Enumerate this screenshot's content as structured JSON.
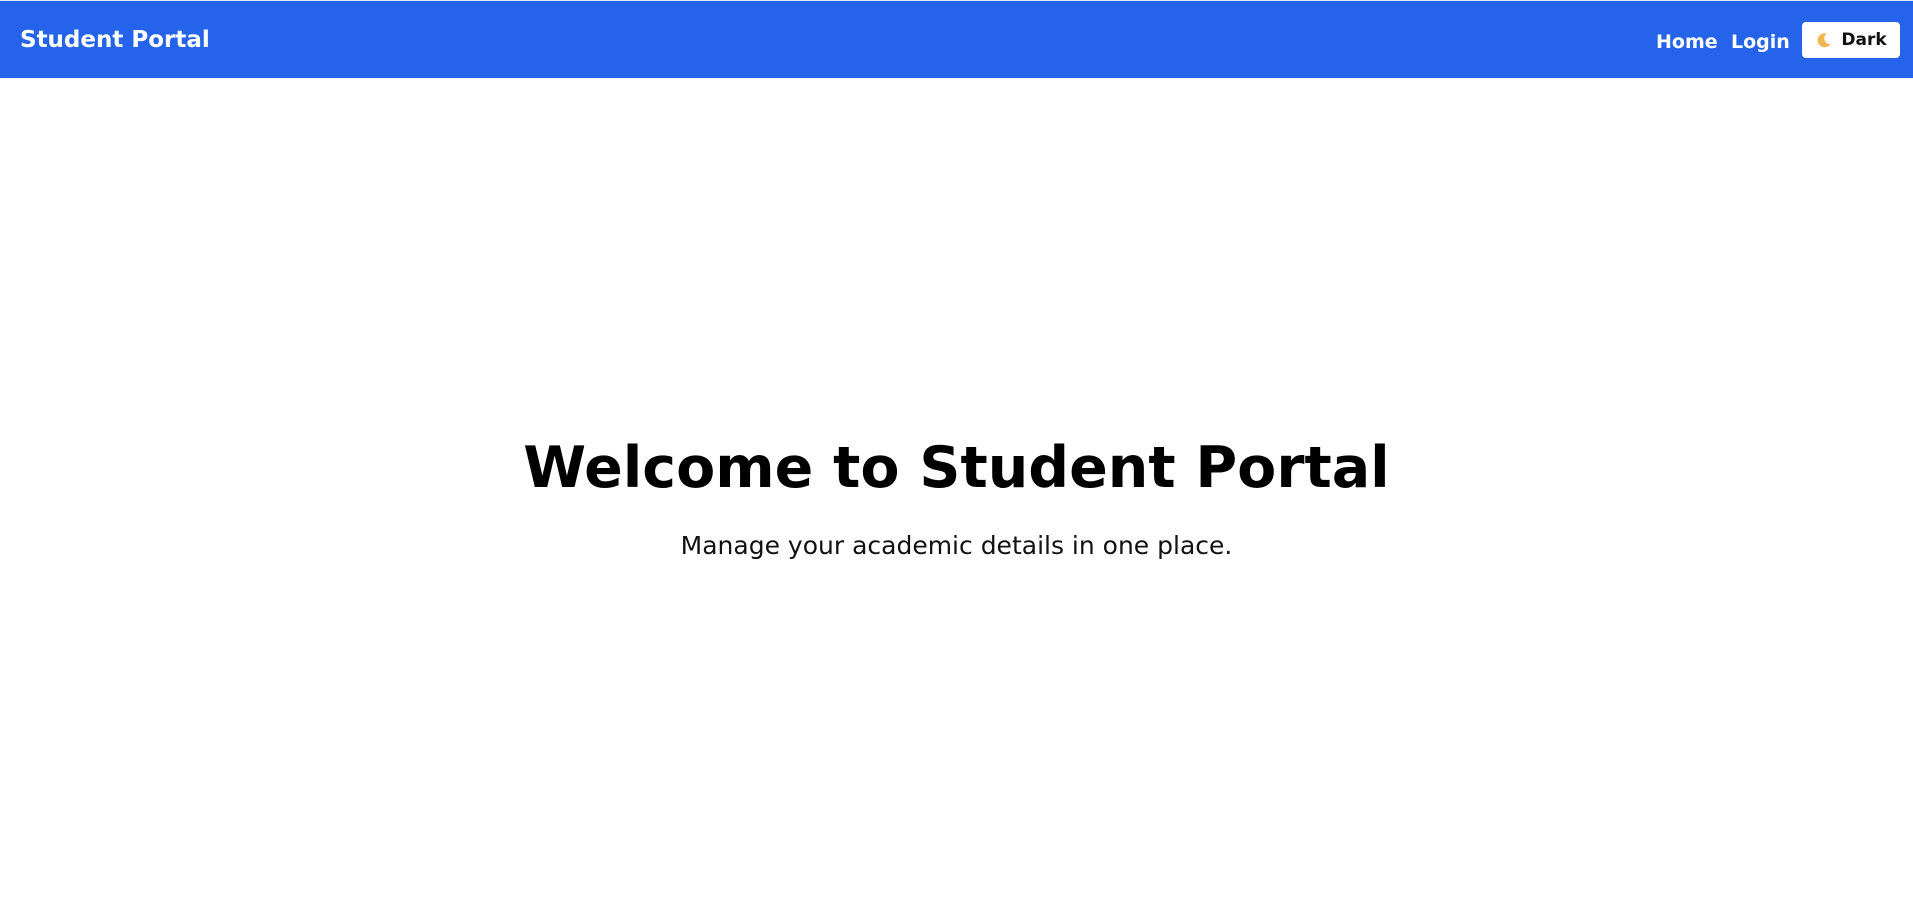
{
  "navbar": {
    "brand": "Student Portal",
    "links": [
      {
        "label": "Home"
      },
      {
        "label": "Login"
      }
    ],
    "theme_toggle": {
      "icon": "moon-icon",
      "label": "Dark"
    },
    "background_color": "#2563eb"
  },
  "hero": {
    "title": "Welcome to Student Portal",
    "subtitle": "Manage your academic details in one place."
  }
}
